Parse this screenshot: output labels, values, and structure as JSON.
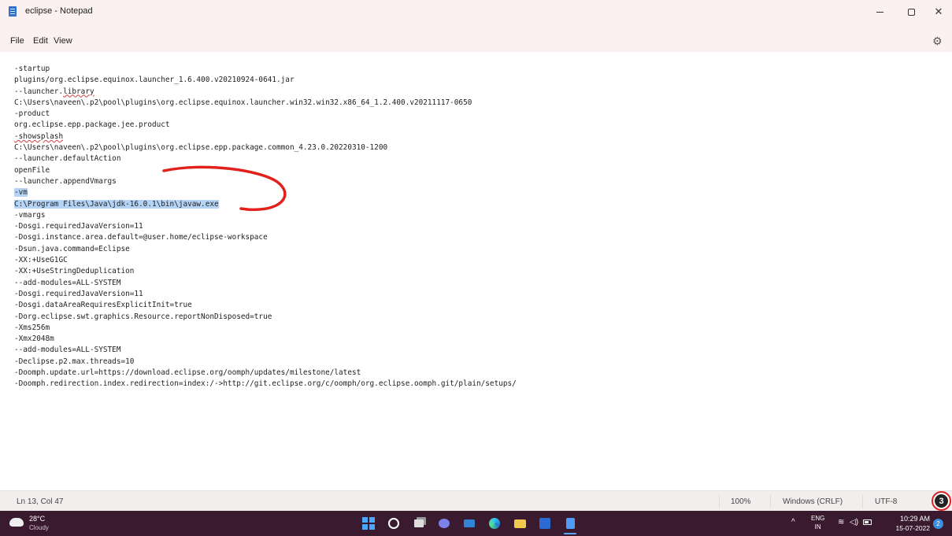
{
  "window": {
    "title": "eclipse - Notepad",
    "controls": {
      "minimize": "",
      "maximize": "",
      "close": "✕"
    }
  },
  "menu": {
    "file": "File",
    "edit": "Edit",
    "view": "View",
    "settings_icon": "⚙"
  },
  "editor": {
    "lines": [
      "-startup",
      "plugins/org.eclipse.equinox.launcher_1.6.400.v20210924-0641.jar",
      "--launcher.library",
      "C:\\Users\\naveen\\.p2\\pool\\plugins\\org.eclipse.equinox.launcher.win32.win32.x86_64_1.2.400.v20211117-0650",
      "-product",
      "org.eclipse.epp.package.jee.product",
      "-showsplash",
      "C:\\Users\\naveen\\.p2\\pool\\plugins\\org.eclipse.epp.package.common_4.23.0.20220310-1200",
      "--launcher.defaultAction",
      "openFile",
      "--launcher.appendVmargs",
      "-vm",
      "C:\\Program Files\\Java\\jdk-16.0.1\\bin\\javaw.exe",
      "-vmargs",
      "-Dosgi.requiredJavaVersion=11",
      "-Dosgi.instance.area.default=@user.home/eclipse-workspace",
      "-Dsun.java.command=Eclipse",
      "-XX:+UseG1GC",
      "-XX:+UseStringDeduplication",
      "--add-modules=ALL-SYSTEM",
      "-Dosgi.requiredJavaVersion=11",
      "-Dosgi.dataAreaRequiresExplicitInit=true",
      "-Dorg.eclipse.swt.graphics.Resource.reportNonDisposed=true",
      "-Xms256m",
      "-Xmx2048m",
      "--add-modules=ALL-SYSTEM",
      "-Declipse.p2.max.threads=10",
      "-Doomph.update.url=https://download.eclipse.org/oomph/updates/milestone/latest",
      "-Doomph.redirection.index.redirection=index:/->http://git.eclipse.org/c/oomph/org.eclipse.oomph.git/plain/setups/"
    ],
    "selected_line_indices": [
      11,
      12
    ],
    "annotation_color": "#e3211c",
    "selection_color": "#b5d4f5"
  },
  "status": {
    "position": "Ln 13, Col 47",
    "zoom": "100%",
    "line_endings": "Windows (CRLF)",
    "encoding": "UTF-8",
    "badge": "3"
  },
  "taskbar": {
    "weather_temp": "28°C",
    "weather_desc": "Cloudy",
    "tray_chevron": "^",
    "lang_top": "ENG",
    "lang_bottom": "IN",
    "wifi_icon": "≋",
    "volume_icon": "◁)",
    "time": "10:29 AM",
    "date": "15-07-2022",
    "notification_count": "2"
  }
}
